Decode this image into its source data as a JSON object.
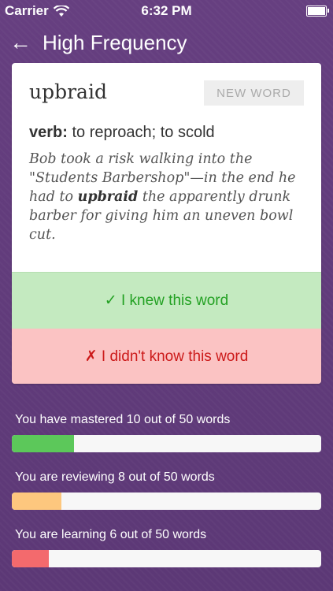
{
  "status_bar": {
    "carrier": "Carrier",
    "time": "6:32 PM"
  },
  "nav": {
    "back_icon": "←",
    "title": "High Frequency"
  },
  "card": {
    "word": "upbraid",
    "badge": "NEW WORD",
    "part_of_speech": "verb:",
    "definition": "to reproach; to scold",
    "example_before": "Bob took a risk walking into the \"Students Barbershop\"—in the end he had to ",
    "example_word": "upbraid",
    "example_after": " the apparently drunk barber for giving him an uneven bowl cut."
  },
  "buttons": {
    "knew": "✓ I knew this word",
    "didnt_know": "✗ I didn't know this word"
  },
  "progress": [
    {
      "label": "You have mastered 10 out of 50 words",
      "fraction": 0.2,
      "color": "#5cc85a"
    },
    {
      "label": "You are reviewing 8 out of 50 words",
      "fraction": 0.16,
      "color": "#fdc77e"
    },
    {
      "label": "You are learning 6 out of 50 words",
      "fraction": 0.12,
      "color": "#f36a6d"
    }
  ]
}
